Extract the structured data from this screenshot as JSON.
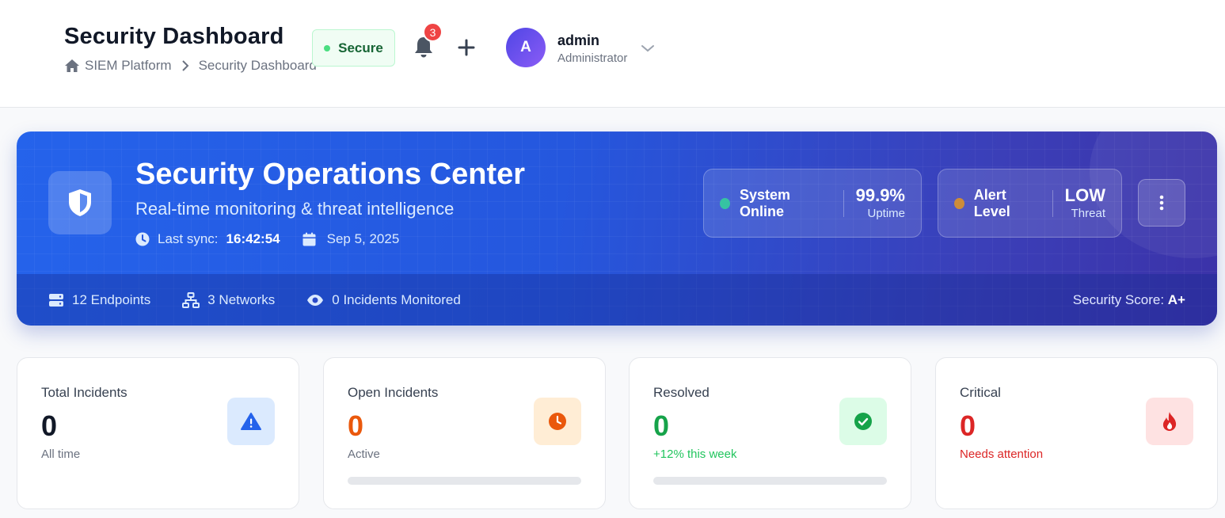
{
  "header": {
    "title": "Security Dashboard",
    "breadcrumb": {
      "root": "SIEM Platform",
      "current": "Security Dashboard"
    },
    "status_badge": "Secure",
    "notification_count": "3",
    "user": {
      "avatar_initial": "A",
      "name": "admin",
      "role": "Administrator"
    }
  },
  "hero": {
    "title": "Security Operations Center",
    "subtitle": "Real-time monitoring & threat intelligence",
    "last_sync_label": "Last sync:",
    "last_sync_time": "16:42:54",
    "date": "Sep 5, 2025",
    "system_status": {
      "label": "System Online",
      "value": "99.9%",
      "caption": "Uptime",
      "dot_color": "#34d399"
    },
    "alert_status": {
      "label": "Alert Level",
      "value": "LOW",
      "caption": "Threat",
      "dot_color": "#f59e0b"
    },
    "footer": {
      "endpoints": "12 Endpoints",
      "networks": "3 Networks",
      "incidents": "0 Incidents Monitored",
      "score_label": "Security Score:",
      "score_value": "A+"
    }
  },
  "cards": [
    {
      "label": "Total Incidents",
      "value": "0",
      "sub": "All time",
      "icon": "warning-icon",
      "accent": "#2563eb"
    },
    {
      "label": "Open Incidents",
      "value": "0",
      "sub": "Active",
      "icon": "clock-icon",
      "accent": "#ea580c"
    },
    {
      "label": "Resolved",
      "value": "0",
      "sub": "+12% this week",
      "icon": "check-circle-icon",
      "accent": "#16a34a"
    },
    {
      "label": "Critical",
      "value": "0",
      "sub": "Needs attention",
      "icon": "fire-icon",
      "accent": "#dc2626"
    }
  ],
  "colors": {
    "brand": "#2563eb",
    "secure": "#166534",
    "danger": "#ef4444"
  }
}
